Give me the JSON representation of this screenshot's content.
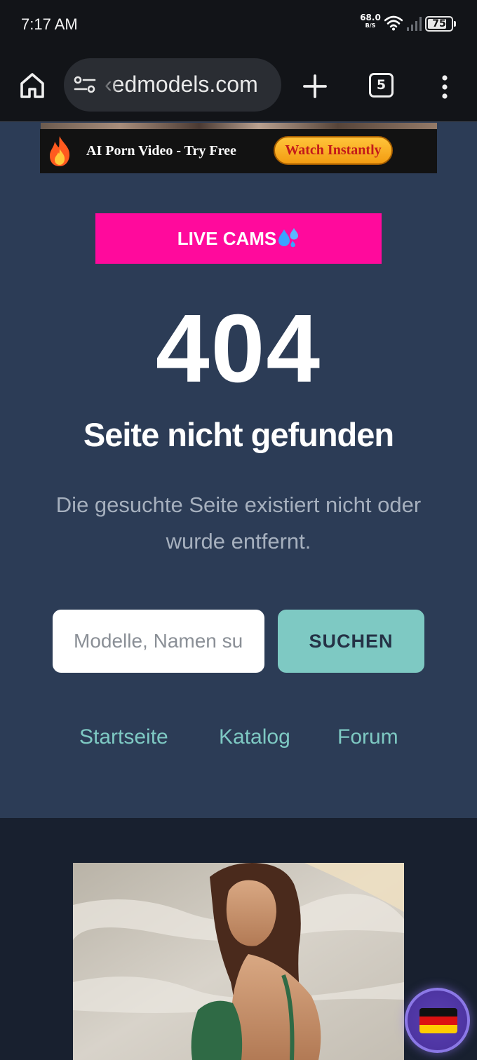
{
  "status_bar": {
    "time": "7:17 AM",
    "net_speed_value": "68.0",
    "net_speed_unit": "B/S",
    "battery_level": "75",
    "icons": [
      "wifi-icon",
      "signal-icon",
      "battery-icon"
    ]
  },
  "browser": {
    "url": "‹edmodels.com",
    "tab_count": "5",
    "icons": [
      "home-icon",
      "site-settings-icon",
      "plus-icon",
      "more-vert-icon"
    ]
  },
  "ad": {
    "text": "AI Porn Video - Try Free",
    "button": "Watch Instantly",
    "icon": "fire-icon"
  },
  "live_cams": {
    "label": "LIVE CAMS",
    "icon": "sweat-droplets-icon",
    "color": "#ff0a9c"
  },
  "error": {
    "code": "404",
    "title": "Seite nicht gefunden",
    "description": "Die gesuchte Seite existiert nicht oder wurde entfernt."
  },
  "search": {
    "placeholder": "Modelle, Namen suchen",
    "button": "SUCHEN",
    "accent_color": "#7ec9c3"
  },
  "nav_links": [
    {
      "label": "Startseite"
    },
    {
      "label": "Katalog"
    },
    {
      "label": "Forum"
    }
  ],
  "language_switcher": {
    "icon": "german-flag-icon"
  },
  "colors": {
    "page_background": "#2c3c56",
    "lower_background": "#18202f",
    "toolbar_background": "#121418"
  }
}
